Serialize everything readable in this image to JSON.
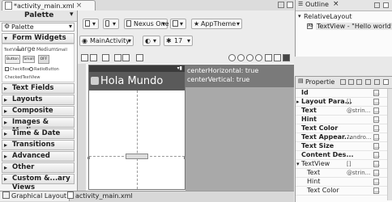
{
  "editor": {
    "tab_title": "*activity_main.xml"
  },
  "palette": {
    "title": "Palette",
    "combo_value": "Palette",
    "categories": [
      "Form Widgets",
      "Text Fields",
      "Layouts",
      "Composite",
      "Images & Media",
      "Time & Date",
      "Transitions",
      "Advanced",
      "Other",
      "Custom &...ary Views"
    ],
    "form_widgets_preview": {
      "textview_sizes": [
        "TextView",
        "Large",
        "Medium",
        "Small"
      ],
      "buttons": [
        "Button",
        "Small",
        "OFF"
      ],
      "checkbox_label": "CheckBox",
      "radio_label": "RadioButton",
      "checked_textview_label": "CheckedTextView"
    }
  },
  "toolbar": {
    "device": "Nexus One",
    "theme": "AppTheme",
    "activity": "MainActivity",
    "api_level": "17"
  },
  "canvas": {
    "app_title": "Hola Mundo",
    "hints": [
      "centerHorizontal: true",
      "centerVertical: true"
    ]
  },
  "bottom_tabs": [
    "Graphical Layout",
    "activity_main.xml"
  ],
  "outline": {
    "title": "Outline",
    "items": [
      "RelativeLayout",
      "TextView - \"Hello world!\""
    ]
  },
  "properties": {
    "title": "Propertie",
    "rows": [
      {
        "name": "Id",
        "value": "",
        "bold": true
      },
      {
        "name": "Layout Para...",
        "value": "[]",
        "bold": true,
        "expandable": true
      },
      {
        "name": "Text",
        "value": "@strin...",
        "bold": true
      },
      {
        "name": "Hint",
        "value": "",
        "bold": true
      },
      {
        "name": "Text Color",
        "value": "",
        "bold": true
      },
      {
        "name": "Text Appear...",
        "value": "?andro...",
        "bold": true
      },
      {
        "name": "Text Size",
        "value": "",
        "bold": true
      },
      {
        "name": "Content Des...",
        "value": "",
        "bold": true
      },
      {
        "name": "TextView",
        "value": "[]",
        "bold": false,
        "expandable": true
      },
      {
        "name": "Text",
        "value": "@strin...",
        "bold": false
      },
      {
        "name": "Hint",
        "value": "",
        "bold": false
      },
      {
        "name": "Text Color",
        "value": "",
        "bold": false
      }
    ]
  }
}
